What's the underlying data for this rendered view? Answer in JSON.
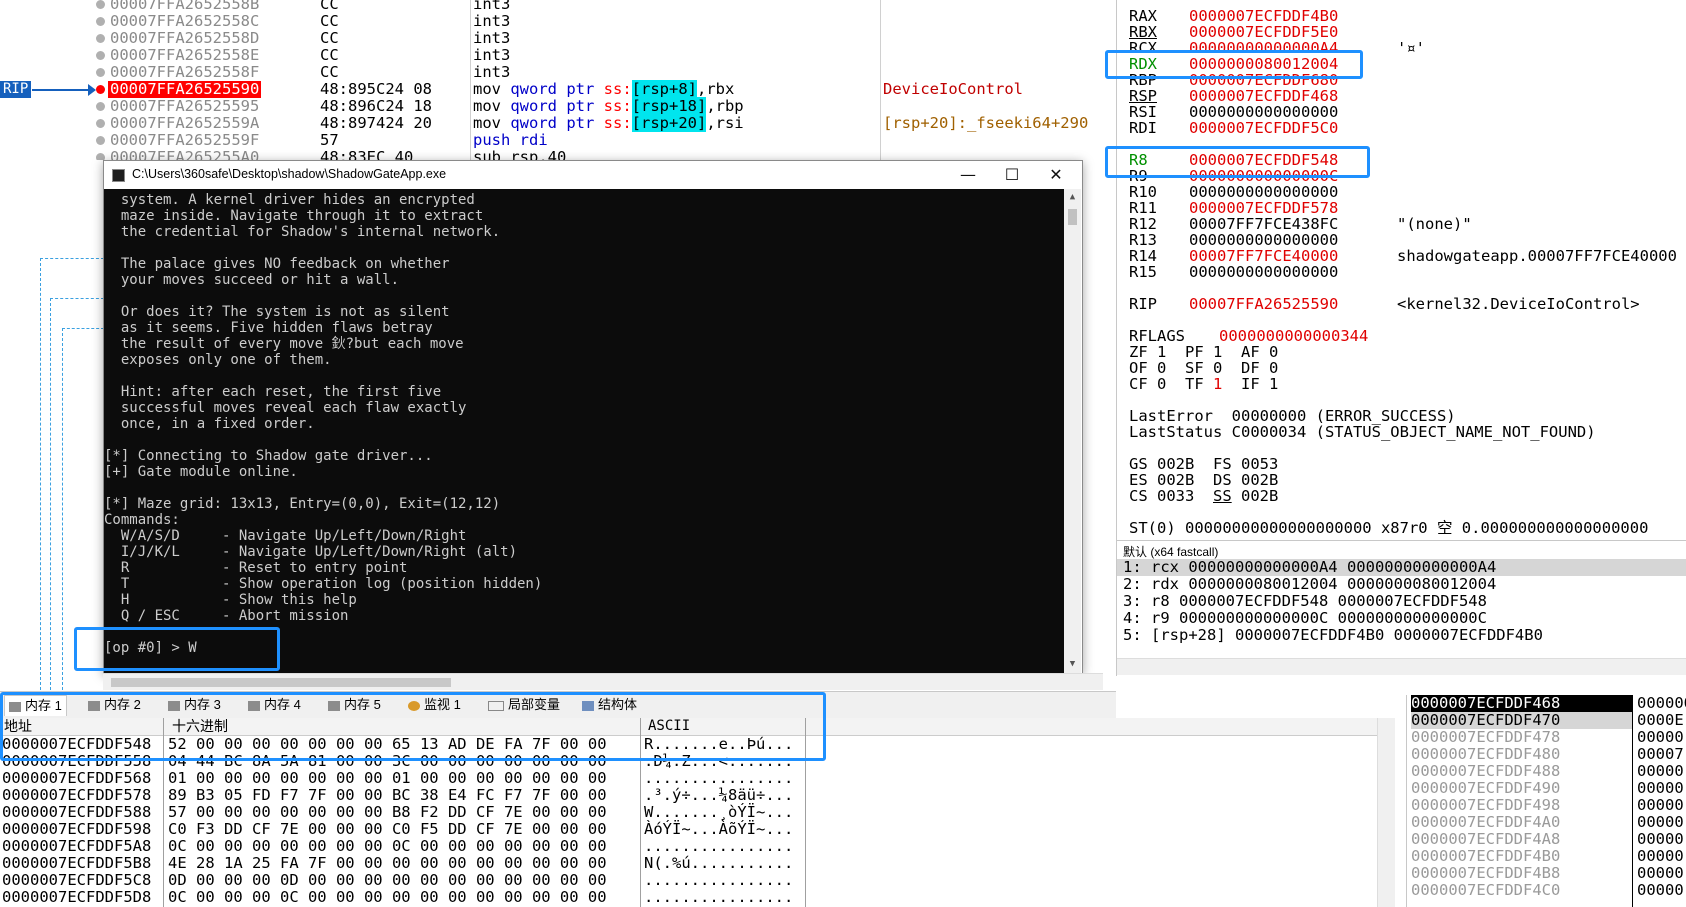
{
  "disasm": {
    "rows": [
      {
        "addr": "00007FFA2652558B",
        "bytes": "CC",
        "instr": "int3",
        "cmt": ""
      },
      {
        "addr": "00007FFA2652558C",
        "bytes": "CC",
        "instr": "int3",
        "cmt": ""
      },
      {
        "addr": "00007FFA2652558D",
        "bytes": "CC",
        "instr": "int3",
        "cmt": ""
      },
      {
        "addr": "00007FFA2652558E",
        "bytes": "CC",
        "instr": "int3",
        "cmt": ""
      },
      {
        "addr": "00007FFA2652558F",
        "bytes": "CC",
        "instr": "int3",
        "cmt": ""
      },
      {
        "addr": "00007FFA26525590",
        "bytes": "48:895C24 08",
        "instr": "",
        "cmt": "DeviceIoControl"
      },
      {
        "addr": "00007FFA26525595",
        "bytes": "48:896C24 18",
        "instr": "",
        "cmt": ""
      },
      {
        "addr": "00007FFA2652559A",
        "bytes": "48:897424 20",
        "instr": "",
        "cmt": "[rsp+20]:_fseeki64+290"
      },
      {
        "addr": "00007FFA2652559F",
        "bytes": "57",
        "instr": "push rdi",
        "cmt": ""
      },
      {
        "addr": "00007FFA265255A0",
        "bytes": "48:83EC 40",
        "instr": "sub rsp,40",
        "cmt": ""
      }
    ],
    "rip_label": "RIP",
    "mov1": {
      "op": "mov ",
      "kw": "qword ptr ",
      "seg": "ss:",
      "br": "[rsp+8]",
      "tail": ",rbx"
    },
    "mov2": {
      "op": "mov ",
      "kw": "qword ptr ",
      "seg": "ss:",
      "br": "[rsp+18]",
      "tail": ",rbp"
    },
    "mov3": {
      "op": "mov ",
      "kw": "qword ptr ",
      "seg": "ss:",
      "br": "[rsp+20]",
      "tail": ",rsi"
    }
  },
  "registers": {
    "rows": [
      {
        "name": "RAX",
        "value": "0000007ECFDDF4B0",
        "cmt": "",
        "red": true
      },
      {
        "name": "RBX",
        "value": "0000007ECFDDF5E0",
        "cmt": "",
        "red": true
      },
      {
        "name": "RCX",
        "value": "00000000000000A4",
        "cmt": "'¤'",
        "red": true
      },
      {
        "name": "RDX",
        "value": "0000000080012004",
        "cmt": "",
        "red": true
      },
      {
        "name": "RBP",
        "value": "0000007ECFDDF680",
        "cmt": "",
        "red": true
      },
      {
        "name": "RSP",
        "value": "0000007ECFDDF468",
        "cmt": "",
        "red": true
      },
      {
        "name": "RSI",
        "value": "0000000000000000",
        "cmt": "",
        "red": false
      },
      {
        "name": "RDI",
        "value": "0000007ECFDDF5C0",
        "cmt": "",
        "red": true
      },
      {
        "name": "R8",
        "value": "0000007ECFDDF548",
        "cmt": "",
        "red": true
      },
      {
        "name": "R9",
        "value": "000000000000000C",
        "cmt": "",
        "red": true
      },
      {
        "name": "R10",
        "value": "0000000000000000",
        "cmt": "",
        "red": false
      },
      {
        "name": "R11",
        "value": "0000007ECFDDF578",
        "cmt": "",
        "red": true
      },
      {
        "name": "R12",
        "value": "00007FF7FCE438FC",
        "cmt": "\"(none)\"",
        "red": false
      },
      {
        "name": "R13",
        "value": "0000000000000000",
        "cmt": "",
        "red": false
      },
      {
        "name": "R14",
        "value": "00007FF7FCE40000",
        "cmt": "shadowgateapp.00007FF7FCE40000",
        "red": true
      },
      {
        "name": "R15",
        "value": "0000000000000000",
        "cmt": "",
        "red": false
      },
      {
        "name": "RIP",
        "value": "00007FFA26525590",
        "cmt": "<kernel32.DeviceIoControl>",
        "red": true
      }
    ],
    "rflags_label": "RFLAGS",
    "rflags_value": "0000000000000344",
    "flags1": "ZF 1  PF 1  AF 0",
    "flags2": "OF 0  SF 0  DF 0",
    "flags3a": "CF 0  TF ",
    "flags3b": "1",
    "flags3c": "  IF 1",
    "lasterror": "LastError  00000000 (ERROR_SUCCESS)",
    "laststatus": "LastStatus C0000034 (STATUS_OBJECT_NAME_NOT_FOUND)",
    "seg1": "GS 002B  FS 0053",
    "seg2": "ES 002B  DS 002B",
    "seg3a": "CS 0033  ",
    "seg3b": "SS",
    "seg3c": " 002B",
    "st0": "ST(0) 00000000000000000000 x87r0 空 0.000000000000000000"
  },
  "args": {
    "title": "默认 (x64 fastcall)",
    "rows": [
      "1: rcx 00000000000000A4 00000000000000A4",
      "2: rdx 0000000080012004 0000000080012004",
      "3: r8 0000007ECFDDF548 0000007ECFDDF548",
      "4: r9 000000000000000C 000000000000000C",
      "5: [rsp+28] 0000007ECFDDF4B0 0000007ECFDDF4B0"
    ]
  },
  "console": {
    "title": "C:\\Users\\360safe\\Desktop\\shadow\\ShadowGateApp.exe",
    "minimize": "—",
    "maximize": "☐",
    "close": "✕",
    "lines": [
      "  system. A kernel driver hides an encrypted",
      "  maze inside. Navigate through it to extract",
      "  the credential for Shadow's internal network.",
      "",
      "  The palace gives NO feedback on whether",
      "  your moves succeed or hit a wall.",
      "",
      "  Or does it? The system is not as silent",
      "  as it seems. Five hidden flaws betray",
      "  the result of every move 鈥?but each move",
      "  exposes only one of them.",
      "",
      "  Hint: after each reset, the first five",
      "  successful moves reveal each flaw exactly",
      "  once, in a fixed order.",
      "",
      "[*] Connecting to Shadow gate driver...",
      "[+] Gate module online.",
      "",
      "[*] Maze grid: 13x13, Entry=(0,0), Exit=(12,12)",
      "Commands:",
      "  W/A/S/D     - Navigate Up/Left/Down/Right",
      "  I/J/K/L     - Navigate Up/Left/Down/Right (alt)",
      "  R           - Reset to entry point",
      "  T           - Show operation log (position hidden)",
      "  H           - Show this help",
      "  Q / ESC     - Abort mission",
      "",
      "[op #0] > W"
    ]
  },
  "tabs": [
    {
      "label": "内存 1",
      "icon": "memory-icon"
    },
    {
      "label": "内存 2",
      "icon": "memory-icon"
    },
    {
      "label": "内存 3",
      "icon": "memory-icon"
    },
    {
      "label": "内存 4",
      "icon": "memory-icon"
    },
    {
      "label": "内存 5",
      "icon": "memory-icon"
    },
    {
      "label": "监视 1",
      "icon": "watch-icon"
    },
    {
      "label": "局部变量",
      "icon": "locals-icon"
    },
    {
      "label": "结构体",
      "icon": "struct-icon"
    }
  ],
  "dump": {
    "hdr_addr": "地址",
    "hdr_hex": "十六进制",
    "hdr_ascii": "ASCII",
    "rows": [
      {
        "addr": "0000007ECFDDF548",
        "hex": "52 00 00 00 00 00 00 00 65 13 AD DE FA 7F 00 00",
        "ascii": "R.......e..Þú..."
      },
      {
        "addr": "0000007ECFDDF558",
        "hex": "04 44 BC 8A 5A 81 00 00 3C 00 00 00 00 00 00 00",
        "ascii": ".D¼.Z...<......."
      },
      {
        "addr": "0000007ECFDDF568",
        "hex": "01 00 00 00 00 00 00 00 01 00 00 00 00 00 00 00",
        "ascii": "................"
      },
      {
        "addr": "0000007ECFDDF578",
        "hex": "89 B3 05 FD F7 7F 00 00 BC 38 E4 FC F7 7F 00 00",
        "ascii": ".³.ý÷...¼8äü÷..."
      },
      {
        "addr": "0000007ECFDDF588",
        "hex": "57 00 00 00 00 00 00 00 B8 F2 DD CF 7E 00 00 00",
        "ascii": "W.......¸òÝÏ~..."
      },
      {
        "addr": "0000007ECFDDF598",
        "hex": "C0 F3 DD CF 7E 00 00 00 C0 F5 DD CF 7E 00 00 00",
        "ascii": "ÀóÝÏ~...ÀõÝÏ~..."
      },
      {
        "addr": "0000007ECFDDF5A8",
        "hex": "0C 00 00 00 00 00 00 00 0C 00 00 00 00 00 00 00",
        "ascii": "................"
      },
      {
        "addr": "0000007ECFDDF5B8",
        "hex": "4E 28 1A 25 FA 7F 00 00 00 00 00 00 00 00 00 00",
        "ascii": "N(.%ú..........."
      },
      {
        "addr": "0000007ECFDDF5C8",
        "hex": "0D 00 00 00 0D 00 00 00 00 00 00 00 00 00 00 00",
        "ascii": "................"
      },
      {
        "addr": "0000007ECFDDF5D8",
        "hex": "0C 00 00 00 0C 00 00 00 00 00 00 00 00 00 00 00",
        "ascii": "................"
      }
    ]
  },
  "stack": {
    "rows": [
      "0000007ECFDDF468",
      "0000007ECFDDF470",
      "0000007ECFDDF478",
      "0000007ECFDDF480",
      "0000007ECFDDF488",
      "0000007ECFDDF490",
      "0000007ECFDDF498",
      "0000007ECFDDF4A0",
      "0000007ECFDDF4A8",
      "0000007ECFDDF4B0",
      "0000007ECFDDF4B8",
      "0000007ECFDDF4C0"
    ],
    "col2": [
      "0000007",
      "0000E",
      "00000",
      "00007",
      "00000",
      "00000",
      "00000",
      "00000",
      "00000",
      "00000",
      "00000",
      "00000"
    ]
  }
}
